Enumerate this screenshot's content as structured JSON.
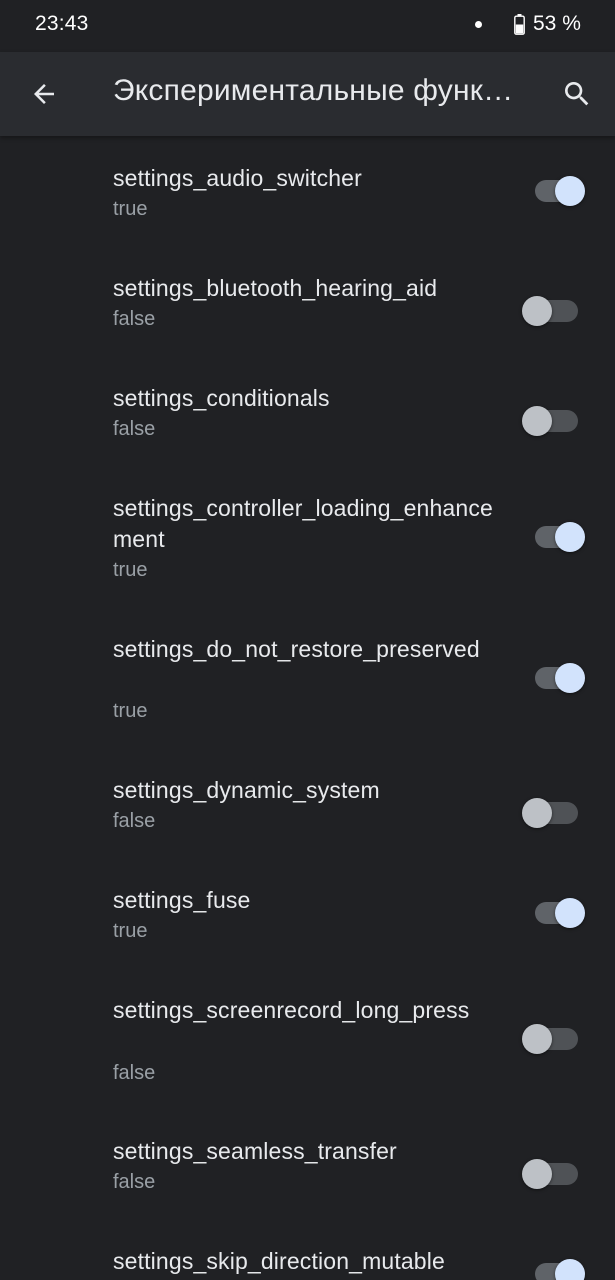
{
  "status_bar": {
    "time": "23:43",
    "battery": "53 %"
  },
  "app_bar": {
    "title": "Экспериментальные функции",
    "back_icon": "arrow-back-icon",
    "search_icon": "search-icon"
  },
  "colors": {
    "background": "#202124",
    "app_bar": "#2a2c30",
    "switch_on_thumb": "#d2e3fc",
    "switch_off_thumb": "#bdc1c6",
    "secondary_text": "#9aa0a6"
  },
  "flags": [
    {
      "name": "settings_audio_switcher",
      "value": "true",
      "enabled": true
    },
    {
      "name": "settings_bluetooth_hearing_aid",
      "value": "false",
      "enabled": false
    },
    {
      "name": "settings_conditionals",
      "value": "false",
      "enabled": false
    },
    {
      "name": "settings_controller_loading_enhancement",
      "value": "true",
      "enabled": true
    },
    {
      "name": "settings_do_not_restore_preserved",
      "value": "true",
      "enabled": true
    },
    {
      "name": "settings_dynamic_system",
      "value": "false",
      "enabled": false
    },
    {
      "name": "settings_fuse",
      "value": "true",
      "enabled": true
    },
    {
      "name": "settings_screenrecord_long_press",
      "value": "false",
      "enabled": false
    },
    {
      "name": "settings_seamless_transfer",
      "value": "false",
      "enabled": false
    },
    {
      "name": "settings_skip_direction_mutable",
      "value": "true",
      "enabled": true
    }
  ]
}
